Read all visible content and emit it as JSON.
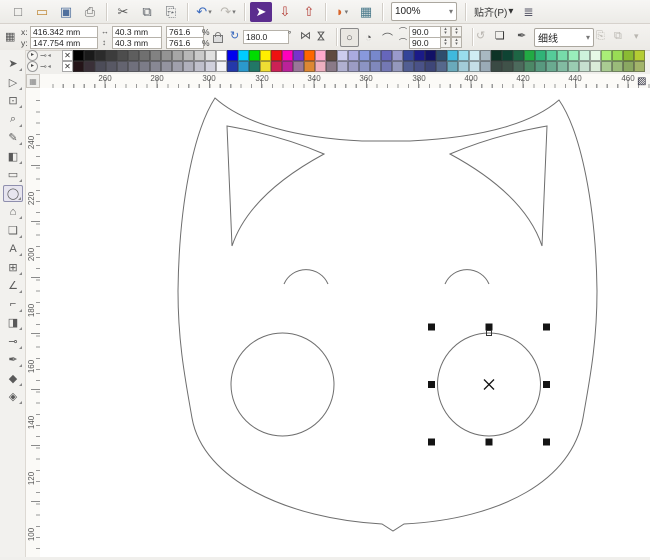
{
  "toolbar": {
    "zoom_level": "100%",
    "snap_label": "贴齐(P)",
    "options_glyph": "≣",
    "items": [
      {
        "name": "new-document-icon",
        "glyph": "□",
        "color": "#6f6f6f"
      },
      {
        "name": "open-folder-icon",
        "glyph": "▭",
        "color": "#c08b3c"
      },
      {
        "name": "save-icon",
        "glyph": "▣",
        "color": "#50709e"
      },
      {
        "name": "print-icon",
        "glyph": "⎙",
        "color": "#666666",
        "divider": true
      },
      {
        "name": "cut-icon",
        "glyph": "✂",
        "color": "#555555"
      },
      {
        "name": "copy-icon",
        "glyph": "⧉",
        "color": "#5a5f66"
      },
      {
        "name": "paste-icon",
        "glyph": "⎘",
        "color": "#5a5f66",
        "divider": true
      },
      {
        "name": "undo-icon",
        "glyph": "↶",
        "color": "#3a6abf",
        "dropdown": true
      },
      {
        "name": "redo-icon",
        "glyph": "↷",
        "color": "#3a6abf",
        "dropdown": true,
        "disabled": true,
        "divider": true
      },
      {
        "name": "search-content-icon",
        "glyph": "➤",
        "color": "#ffffff",
        "bg": "#5b2d8e"
      },
      {
        "name": "import-icon",
        "glyph": "⇩",
        "color": "#b23a32"
      },
      {
        "name": "export-icon",
        "glyph": "⇧",
        "color": "#b23a32",
        "divider": true
      },
      {
        "name": "app-launcher-icon",
        "glyph": "◗",
        "color": "#d9652a",
        "dropdown": true
      },
      {
        "name": "welcome-screen-icon",
        "glyph": "▦",
        "color": "#48788a",
        "divider": true
      }
    ]
  },
  "property_bar": {
    "x_label": "x:",
    "x_value": "416.342 mm",
    "y_label": "y:",
    "y_value": "147.754 mm",
    "width_value": "40.3 mm",
    "height_value": "40.3 mm",
    "scale_h": "761.6",
    "scale_v": "761.6",
    "percent_h": "%",
    "percent_v": "%",
    "rotation_value": "180.0",
    "degree_symbol": "°",
    "arc_start": "90.0",
    "arc_end": "90.0",
    "outline_width": "细线",
    "icons": {
      "position": "▦",
      "width": "↔",
      "height": "↕",
      "rotate": "↻",
      "mirror_h": "⋈",
      "mirror_v": "⋈",
      "ellipse": "○",
      "pie": "◔",
      "arc": "⌒",
      "arc_small": "⌒",
      "direction": "↺",
      "wrap": "❏",
      "pen": "✒",
      "gray1": "⎘",
      "gray2": "⧉",
      "gray3": "▾"
    }
  },
  "palette": {
    "no_color_glyph": "✕",
    "row1": [
      "none",
      "#000000",
      "#1a1a1a",
      "#2b2b2b",
      "#3c3c3c",
      "#4d4d4d",
      "#5e5e5e",
      "#707070",
      "#828282",
      "#949494",
      "#a6a6a6",
      "#b8b8b8",
      "#cacaca",
      "#e0e0e0",
      "#ffffff",
      "#0000ee",
      "#00ccff",
      "#00dd00",
      "#ffee00",
      "#ee1111",
      "#ff00bb",
      "#7733cc",
      "#ff6600",
      "#ffaacc",
      "#5f4a40",
      "#ccccee",
      "#aaaae0",
      "#8899dd",
      "#7788cc",
      "#6666bb",
      "#9999cc",
      "#334499",
      "#1a1a88",
      "#111166",
      "#2e4d6e",
      "#3fb9dd",
      "#99dded",
      "#cfecf4",
      "#a8b8c2",
      "#0d3326",
      "#0e4433",
      "#1d6644",
      "#22aa44",
      "#2fb377",
      "#55cc99",
      "#77dcaa",
      "#99eebb",
      "#cdf2dc",
      "#e6f9e6",
      "#aaee77",
      "#99dd55",
      "#8abb33",
      "#b4cc33"
    ],
    "row2": [
      "none",
      "#241418",
      "#3a3038",
      "#4c4c58",
      "#585864",
      "#646470",
      "#70707c",
      "#7c7c88",
      "#888894",
      "#9494a0",
      "#a0a0ac",
      "#b0b0bc",
      "#c0c0cc",
      "#d0d0dc",
      "#f2f2f6",
      "#2438aa",
      "#2b99cc",
      "#227766",
      "#eedd33",
      "#cc2255",
      "#bb2299",
      "#997799",
      "#dd8833",
      "#eeb0c0",
      "#8a7a88",
      "#b0b0d0",
      "#9c9cc4",
      "#8c94c4",
      "#8088bc",
      "#7478b4",
      "#9498bc",
      "#525e92",
      "#4a5288",
      "#3e4678",
      "#56688c",
      "#6aaabb",
      "#a2ccd8",
      "#c4dee6",
      "#9aaab6",
      "#3a4a44",
      "#405249",
      "#4c6a5c",
      "#4c8866",
      "#58997f",
      "#6aaa90",
      "#82bba2",
      "#9accb2",
      "#c6e0d0",
      "#daecd9",
      "#aacc92",
      "#9abb7a",
      "#8aa862",
      "#a2b46a"
    ]
  },
  "rulers": {
    "horizontal": {
      "labels": [
        260,
        280,
        300,
        320,
        340,
        360,
        380,
        400,
        420,
        440,
        460
      ],
      "positions": [
        65,
        117,
        169,
        222,
        274,
        326,
        379,
        431,
        483,
        535,
        588
      ]
    },
    "vertical": {
      "labels": [
        240,
        220,
        200,
        180,
        160,
        140,
        120,
        100
      ],
      "positions": [
        50,
        106,
        162,
        218,
        274,
        330,
        386,
        442
      ]
    },
    "corner_glyph": "▨"
  },
  "toolbox": {
    "selected_index": 7,
    "tools": [
      {
        "name": "pick-tool",
        "glyph": "➤"
      },
      {
        "name": "shape-tool",
        "glyph": "▷"
      },
      {
        "name": "crop-tool",
        "glyph": "⊡"
      },
      {
        "name": "zoom-tool",
        "glyph": "⌕"
      },
      {
        "name": "freehand-tool",
        "glyph": "✎"
      },
      {
        "name": "smart-fill-tool",
        "glyph": "◧"
      },
      {
        "name": "rectangle-tool",
        "glyph": "▭"
      },
      {
        "name": "ellipse-tool",
        "glyph": "◯"
      },
      {
        "name": "polygon-tool",
        "glyph": "⌂"
      },
      {
        "name": "basic-shapes-tool",
        "glyph": "❑"
      },
      {
        "name": "text-tool",
        "glyph": "A"
      },
      {
        "name": "table-tool",
        "glyph": "⊞"
      },
      {
        "name": "dimension-tool",
        "glyph": "∠"
      },
      {
        "name": "connector-tool",
        "glyph": "⌐"
      },
      {
        "name": "blend-tool",
        "glyph": "◨"
      },
      {
        "name": "eyedropper-tool",
        "glyph": "⊸"
      },
      {
        "name": "outline-pen-tool",
        "glyph": "✒"
      },
      {
        "name": "fill-tool",
        "glyph": "◆"
      },
      {
        "name": "interactive-fill-tool",
        "glyph": "◈"
      }
    ]
  },
  "colors": {
    "chrome": "#f0efec",
    "chrome_border": "#d6d2cc",
    "canvas": "#ffffff",
    "ruler_bg": "#fbfaf7",
    "edge_blue": "#9db8d6",
    "corner_dark": "#3d4650",
    "outline_stroke": "#6e6e6e",
    "selection_handle": "#141414"
  }
}
